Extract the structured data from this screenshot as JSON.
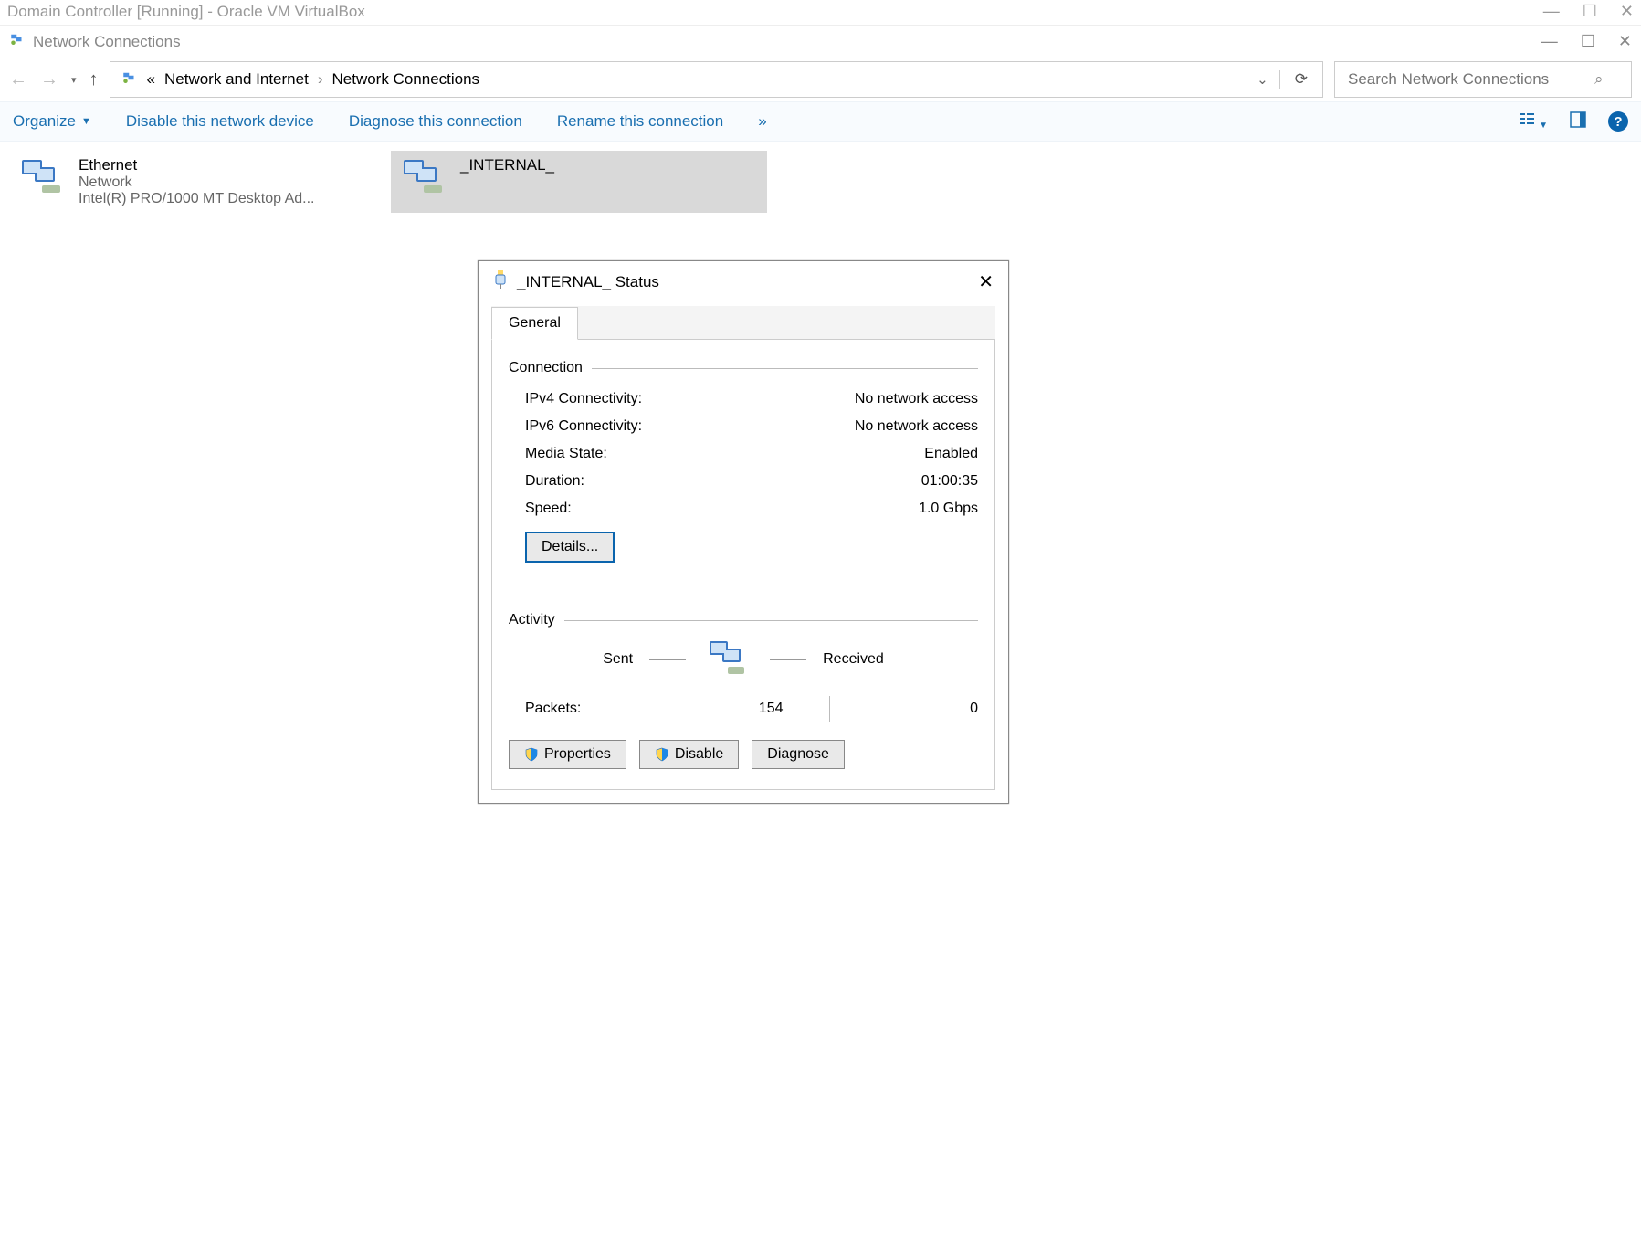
{
  "virtualbox": {
    "title": "Domain Controller [Running] - Oracle VM VirtualBox"
  },
  "window": {
    "title": "Network Connections"
  },
  "breadcrumbs": {
    "level1": "Network and Internet",
    "level2": "Network Connections"
  },
  "search": {
    "placeholder": "Search Network Connections"
  },
  "toolbar": {
    "organize": "Organize",
    "disable": "Disable this network device",
    "diagnose": "Diagnose this connection",
    "rename": "Rename this connection",
    "more": "»"
  },
  "connections": [
    {
      "name": "Ethernet",
      "status": "Network",
      "adapter": "Intel(R) PRO/1000 MT Desktop Ad..."
    },
    {
      "name": "_INTERNAL_",
      "status": "",
      "adapter": ""
    }
  ],
  "dialog": {
    "title": "_INTERNAL_ Status",
    "tab": "General",
    "section_connection": "Connection",
    "rows": {
      "ipv4_label": "IPv4 Connectivity:",
      "ipv4_value": "No network access",
      "ipv6_label": "IPv6 Connectivity:",
      "ipv6_value": "No network access",
      "media_label": "Media State:",
      "media_value": "Enabled",
      "duration_label": "Duration:",
      "duration_value": "01:00:35",
      "speed_label": "Speed:",
      "speed_value": "1.0 Gbps"
    },
    "details_btn": "Details...",
    "section_activity": "Activity",
    "activity": {
      "sent_label": "Sent",
      "received_label": "Received",
      "packets_label": "Packets:",
      "packets_sent": "154",
      "packets_received": "0"
    },
    "buttons": {
      "properties": "Properties",
      "disable": "Disable",
      "diagnose": "Diagnose"
    }
  }
}
